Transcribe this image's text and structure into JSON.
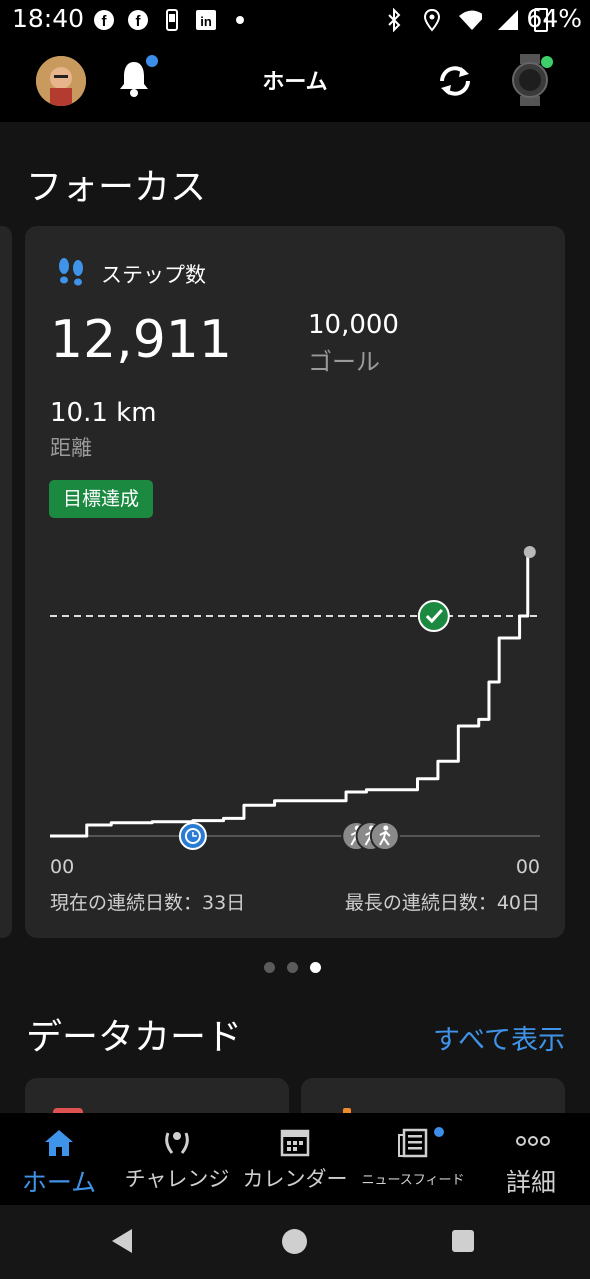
{
  "status_bar": {
    "time": "18:40",
    "battery": "64%",
    "icons": [
      "facebook-icon",
      "facebook-icon",
      "phone-notification-icon",
      "linkedin-icon",
      "dot-icon",
      "bluetooth-icon",
      "location-icon",
      "wifi-icon",
      "signal-icon",
      "battery-charging-icon"
    ]
  },
  "app_bar": {
    "title": "ホーム",
    "icons": [
      "avatar",
      "bell-icon",
      "sync-icon",
      "watch-icon"
    ]
  },
  "focus": {
    "section_title": "フォーカス",
    "card": {
      "title": "ステップ数",
      "steps": "12,911",
      "goal_value": "10,000",
      "goal_label": "ゴール",
      "distance_value": "10.1 km",
      "distance_label": "距離",
      "badge": "目標達成",
      "axis_left": "00",
      "axis_right": "00",
      "current_streak": "現在の連続日数：33日",
      "longest_streak": "最長の連続日数：40日"
    },
    "pager": {
      "pages": 3,
      "active_index": 2
    }
  },
  "data_cards": {
    "section_title": "データカード",
    "view_all": "すべて表示"
  },
  "bottom_nav": {
    "items": [
      {
        "label": "ホーム",
        "icon": "home-icon"
      },
      {
        "label": "チャレンジ",
        "icon": "laurel-icon"
      },
      {
        "label": "カレンダー",
        "icon": "calendar-icon"
      },
      {
        "label": "ニュースフィード",
        "icon": "newsfeed-icon"
      },
      {
        "label": "詳細",
        "icon": "more-icon"
      }
    ],
    "active_index": 0
  },
  "colors": {
    "accent": "#3f93e8",
    "goal_badge": "#1b8a40",
    "card": "#262626",
    "background": "#141414"
  },
  "chart_data": {
    "type": "line",
    "title": "ステップ数",
    "xlabel": "",
    "ylabel": "",
    "x_tick_labels": [
      "00",
      "00"
    ],
    "x_range_hours": [
      0,
      24
    ],
    "goal": 10000,
    "ylim": [
      0,
      12911
    ],
    "series": [
      {
        "x": [
          0,
          1.2,
          1.8,
          3.0,
          5.0,
          7.0,
          8.5,
          9.5,
          11.0,
          14.5,
          15.5,
          17.0,
          18.0,
          19.0,
          20.0,
          21.0,
          21.5,
          22.0,
          23.0,
          23.4,
          23.5
        ],
        "y": [
          0,
          0,
          500,
          600,
          650,
          700,
          800,
          1400,
          1600,
          2000,
          2100,
          2100,
          2600,
          3400,
          5000,
          5300,
          7000,
          9000,
          10000,
          12800,
          12911
        ]
      }
    ],
    "markers": [
      {
        "x": 7.0,
        "kind": "clock"
      },
      {
        "x": 15.0,
        "kind": "walk"
      },
      {
        "x": 15.7,
        "kind": "walk"
      },
      {
        "x": 16.4,
        "kind": "walk"
      },
      {
        "x": 18.8,
        "kind": "goal-check"
      }
    ]
  }
}
